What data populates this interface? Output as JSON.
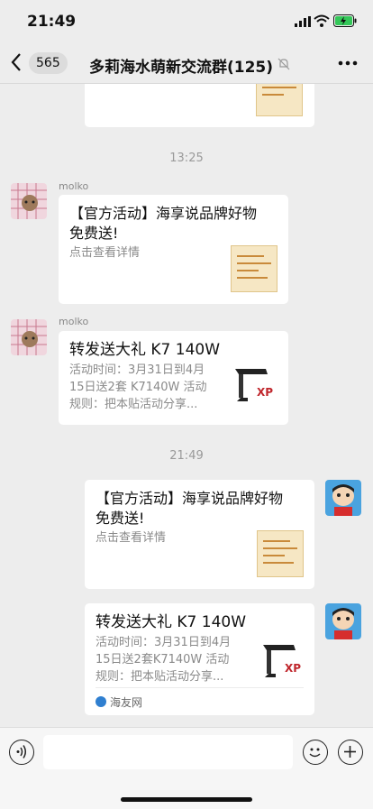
{
  "status": {
    "time": "21:49"
  },
  "header": {
    "back_count": "565",
    "title": "多莉海水萌新交流群(125)"
  },
  "messages": {
    "time_1": "13:25",
    "time_2": "21:49",
    "sender_1": "molko",
    "sender_2": "molko",
    "card_1": {
      "title": "【官方活动】海享说品牌好物\n免费送!",
      "desc": "点击查看详情"
    },
    "card_2": {
      "title": "转发送大礼 K7 140W",
      "desc": "活动时间：3月31日到4月\n15日送2套 K7140W 活动\n规则：把本贴活动分享..."
    },
    "card_3": {
      "title": "【官方活动】海享说品牌好物\n免费送!",
      "desc": "点击查看详情"
    },
    "card_4": {
      "title": "转发送大礼 K7 140W",
      "desc": "活动时间：3月31日到4月\n15日送2套K7140W 活动\n规则：把本贴活动分享...",
      "source": "海友网"
    }
  },
  "icons": {
    "back": "chevron-left-icon",
    "mute": "bell-off-icon",
    "more": "ellipsis-icon",
    "voice": "voice-icon",
    "emoji": "smiley-icon",
    "plus": "plus-icon"
  },
  "colors": {
    "background": "#ededed",
    "card": "#ffffff",
    "muted_text": "#8a8a8a",
    "battery_green": "#34c759"
  }
}
